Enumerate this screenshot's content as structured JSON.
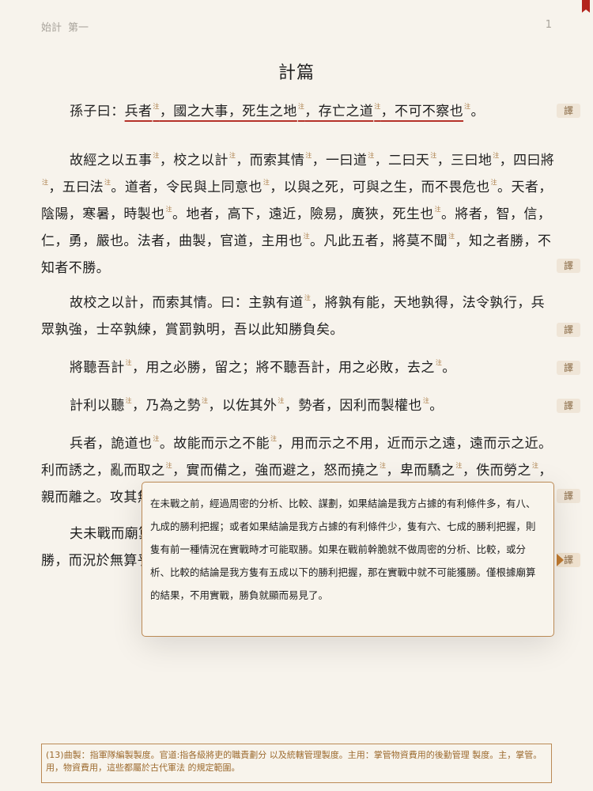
{
  "header": {
    "book": "始計",
    "section": "第一",
    "page_number": "1"
  },
  "chapter_title": "計篇",
  "note_marker": "注",
  "translate_label": "譯",
  "paragraphs": {
    "p1": {
      "a": "孫子曰：",
      "b": "兵者",
      "c": "，國之大事，死生之地",
      "d": "，存亡之道",
      "e": "，不可不察也",
      "f": "。"
    },
    "p2": {
      "a": "故經之以五事",
      "b": "，校之以計",
      "c": "，而索其情",
      "d": "，一曰道",
      "e": "，二曰天",
      "f": "，三曰地",
      "g": "，四曰將",
      "h": "，五曰法",
      "i": "。道者，令民與上同意也",
      "j": "，以與之死，可與之生，而不畏危也",
      "k": "。天者，陰陽，寒暑，時製也",
      "l": "。地者，高下，遠近，險易，廣狹，死生也",
      "m": "。將者，智，信，仁，勇，嚴也。法者，曲製，官道，主用也",
      "n": "。凡此五者，將莫不聞",
      "o": "，知之者勝，不知者不勝。"
    },
    "p3": {
      "a": "故校之以計，而索其情。曰：主孰有道",
      "b": "，將孰有能，天地孰得，法令孰行，兵眾孰強，士卒孰練，賞罰孰明，吾以此知勝負矣。"
    },
    "p4": {
      "a": "將聽吾計",
      "b": "，用之必勝，留之；將不聽吾計，用之必敗，去之",
      "c": "。"
    },
    "p5": {
      "a": "計利以聽",
      "b": "，乃為之勢",
      "c": "，以佐其外",
      "d": "，勢者，因利而製權也",
      "e": "。"
    },
    "p6": {
      "a": "兵者，詭道也",
      "b": "。故能而示之不能",
      "c": "，用而示之不用，近而示之遠，遠而示之近。利而誘之，亂而取之",
      "d": "，實而備之，強而避之，怒而撓之",
      "e": "，卑而驕之",
      "f": "，佚而勞之",
      "g": "，親而離之。攻其無備"
    },
    "p7": {
      "a": "夫未戰而廟算勝者，得算多也；未戰而廟算不勝者，得算少也。多算勝，少算不勝，而況於無算乎！"
    }
  },
  "translation_popup": {
    "text": "在未戰之前，經過周密的分析、比較、謀劃，如果結論是我方占據的有利條件多，有八、九成的勝利把握；或者如果結論是我方占據的有利條件少，隻有六、七成的勝利把握，則隻有前一種情況在實戰時才可能取勝。如果在戰前幹脆就不做周密的分析、比較，或分析、比較的結論是我方隻有五成以下的勝利把握，那在實戰中就不可能獲勝。僅根據廟算的結果，不用實戰，勝負就顯而易見了。"
  },
  "footnote": {
    "text": "(13)曲製：指軍隊編製製度。官道:指各級將吏的職責劃分 以及統轄管理製度。主用：掌管物資費用的後勤管理 製度。主，掌管。用，物資費用，這些都屬於古代軍法 的規定範圍。"
  },
  "colors": {
    "background": "#f7f3ec",
    "accent": "#a87a43",
    "underline": "#b5322a",
    "bookmark": "#b3231c"
  }
}
